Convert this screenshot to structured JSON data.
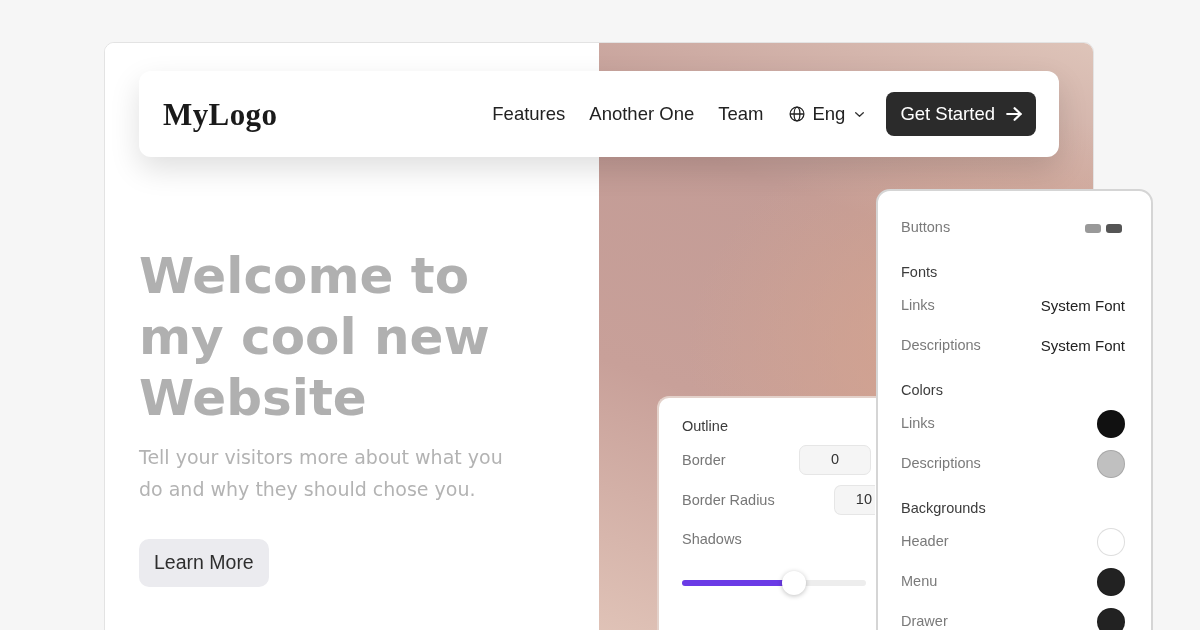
{
  "nav": {
    "logo": "MyLogo",
    "links": [
      "Features",
      "Another One",
      "Team"
    ],
    "language": "Eng",
    "cta": "Get Started"
  },
  "hero": {
    "title": "Welcome to my cool new Website",
    "subtitle": "Tell your visitors more about what you do and why they should chose you.",
    "button": "Learn More"
  },
  "outline_panel": {
    "heading": "Outline",
    "fields": [
      {
        "label": "Border",
        "value": "0"
      },
      {
        "label": "Border Radius",
        "value": "10"
      }
    ],
    "slider": {
      "label": "Shadows",
      "level": 0.61
    }
  },
  "style_panel": {
    "buttons": {
      "label": "Buttons",
      "swatches": [
        {
          "color": "#999999"
        },
        {
          "color": "#555555"
        }
      ]
    },
    "sections": [
      {
        "heading": "Fonts",
        "rows": [
          {
            "kind": "font",
            "label": "Links",
            "value": "System Font"
          },
          {
            "kind": "font",
            "label": "Descriptions",
            "value": "System Font"
          }
        ]
      },
      {
        "heading": "Colors",
        "rows": [
          {
            "kind": "color",
            "label": "Links",
            "color": "#111111"
          },
          {
            "kind": "color",
            "label": "Descriptions",
            "color": "#c0c0c0"
          }
        ]
      },
      {
        "heading": "Backgrounds",
        "rows": [
          {
            "kind": "color",
            "label": "Header",
            "color": "#ffffff"
          },
          {
            "kind": "color",
            "label": "Menu",
            "color": "#222222"
          },
          {
            "kind": "color",
            "label": "Drawer",
            "color": "#222222"
          }
        ]
      }
    ]
  }
}
